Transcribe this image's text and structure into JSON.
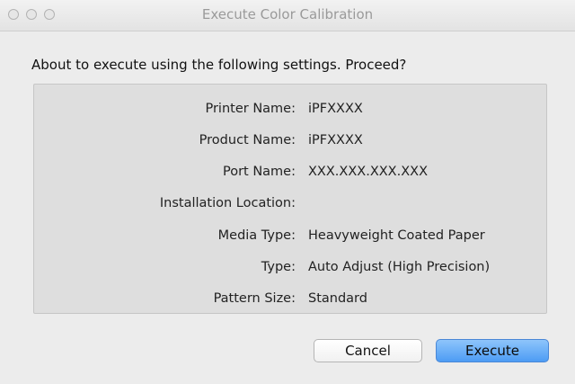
{
  "window": {
    "title": "Execute Color Calibration"
  },
  "dialog": {
    "prompt": "About to execute using the following settings. Proceed?",
    "settings": [
      {
        "label": "Printer Name:",
        "value": "iPFXXXX"
      },
      {
        "label": "Product Name:",
        "value": "iPFXXXX"
      },
      {
        "label": "Port Name:",
        "value": "XXX.XXX.XXX.XXX"
      },
      {
        "label": "Installation Location:",
        "value": ""
      },
      {
        "label": "Media Type:",
        "value": "Heavyweight Coated Paper"
      },
      {
        "label": "Type:",
        "value": "Auto Adjust (High Precision)"
      },
      {
        "label": "Pattern Size:",
        "value": "Standard"
      }
    ]
  },
  "buttons": {
    "cancel_label": "Cancel",
    "execute_label": "Execute"
  },
  "colors": {
    "accent": "#4d9cf4",
    "panel": "#dedede",
    "window": "#ececec"
  }
}
